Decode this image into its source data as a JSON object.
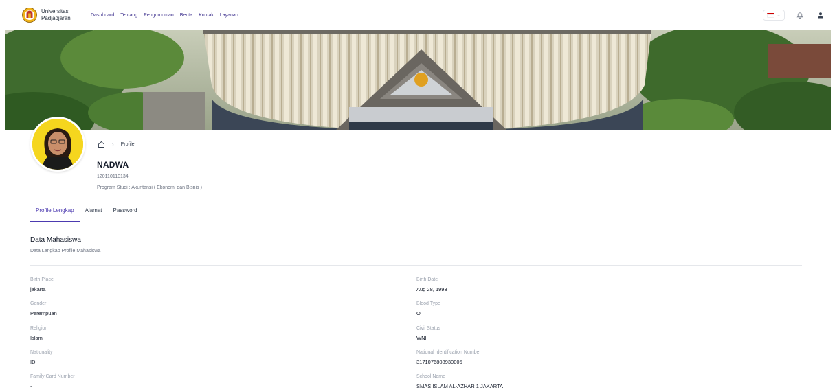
{
  "brand": {
    "line1": "Universitas",
    "line2": "Padjadjaran",
    "logo_icon": "unpad-logo-icon"
  },
  "nav": [
    "Dashboard",
    "Tentang",
    "Pengumuman",
    "Berita",
    "Kontak",
    "Layanan"
  ],
  "header_right": {
    "language_flag": "id-flag-icon",
    "notification_icon": "bell-icon",
    "user_icon": "user-icon"
  },
  "breadcrumb": {
    "home_icon": "home-icon",
    "current": "Profile"
  },
  "profile": {
    "name": "NADWA",
    "nim": "120110110134",
    "prodi": "Program Studi : Akuntansi ( Ekonomi dan Bisnis )"
  },
  "tabs": [
    {
      "label": "Profile Lengkap",
      "active": true
    },
    {
      "label": "Alamat",
      "active": false
    },
    {
      "label": "Password",
      "active": false
    }
  ],
  "section": {
    "title": "Data Mahasiswa",
    "subtitle": "Data Lengkap Profile Mahasiswa"
  },
  "fields_left": [
    {
      "label": "Birth Place",
      "value": "jakarta"
    },
    {
      "label": "Gender",
      "value": "Perempuan"
    },
    {
      "label": "Religion",
      "value": "Islam"
    },
    {
      "label": "Nationality",
      "value": "ID"
    },
    {
      "label": "Family Card Number",
      "value": "-"
    }
  ],
  "fields_right": [
    {
      "label": "Birth Date",
      "value": "Aug 28, 1993"
    },
    {
      "label": "Blood Type",
      "value": "O"
    },
    {
      "label": "Civil Status",
      "value": "WNI"
    },
    {
      "label": "National Identification Number",
      "value": "3171076808930005"
    },
    {
      "label": "School Name",
      "value": "SMAS ISLAM AL-AZHAR 1 JAKARTA"
    }
  ],
  "colors": {
    "accent": "#4c3ab0",
    "nav_text": "#3b2e8c",
    "avatar_bg": "#f5d61e"
  }
}
